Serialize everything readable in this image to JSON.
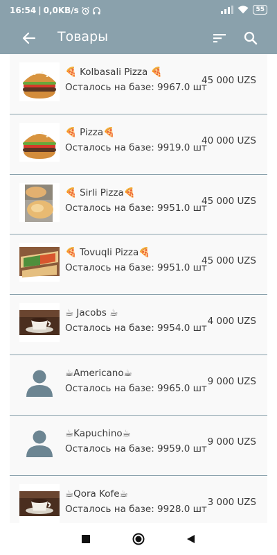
{
  "status": {
    "time": "16:54",
    "speed": "0,0KB/s",
    "battery": "55",
    "icons": [
      "alarm-icon",
      "headphones-icon",
      "signal-icon",
      "wifi-icon",
      "battery-icon"
    ]
  },
  "appbar": {
    "title": "Товары",
    "icons": [
      "back-arrow-icon",
      "sort-icon",
      "search-icon"
    ]
  },
  "colors": {
    "bar": "#8aa1ac",
    "divider": "#8aa1ac",
    "text": "#3b3b3b",
    "background": "#f9f9f9"
  },
  "products": [
    {
      "name": "🍕 Kolbasali Pizza 🍕",
      "stock": "Осталось на базе: 9967.0 шт",
      "price": "45 000 UZS",
      "image": "burger"
    },
    {
      "name": "🍕 Pizza🍕",
      "stock": "Осталось на базе: 9919.0 шт",
      "price": "40 000 UZS",
      "image": "burger"
    },
    {
      "name": "🍕 Sirli Pizza🍕",
      "stock": "Осталось на базе: 9951.0 шт",
      "price": "45 000 UZS",
      "image": "bun"
    },
    {
      "name": "🍕 Tovuqli Pizza🍕",
      "stock": "Осталось на базе: 9951.0 шт",
      "price": "45 000 UZS",
      "image": "wrap"
    },
    {
      "name": "☕ Jacobs ☕",
      "stock": "Осталось на базе: 9954.0 шт",
      "price": "4 000 UZS",
      "image": "coffee"
    },
    {
      "name": "☕Americano☕",
      "stock": "Осталось на базе: 9965.0 шт",
      "price": "9 000 UZS",
      "image": "person"
    },
    {
      "name": "☕Kapuchino☕",
      "stock": "Осталось на базе: 9959.0 шт",
      "price": "9 000 UZS",
      "image": "person"
    },
    {
      "name": "☕Qora Kofe☕",
      "stock": "Осталось на базе: 9928.0 шт",
      "price": "3 000 UZS",
      "image": "coffee"
    }
  ],
  "navbar": {
    "icons": [
      "recents-square-icon",
      "home-circle-icon",
      "back-triangle-icon"
    ]
  }
}
